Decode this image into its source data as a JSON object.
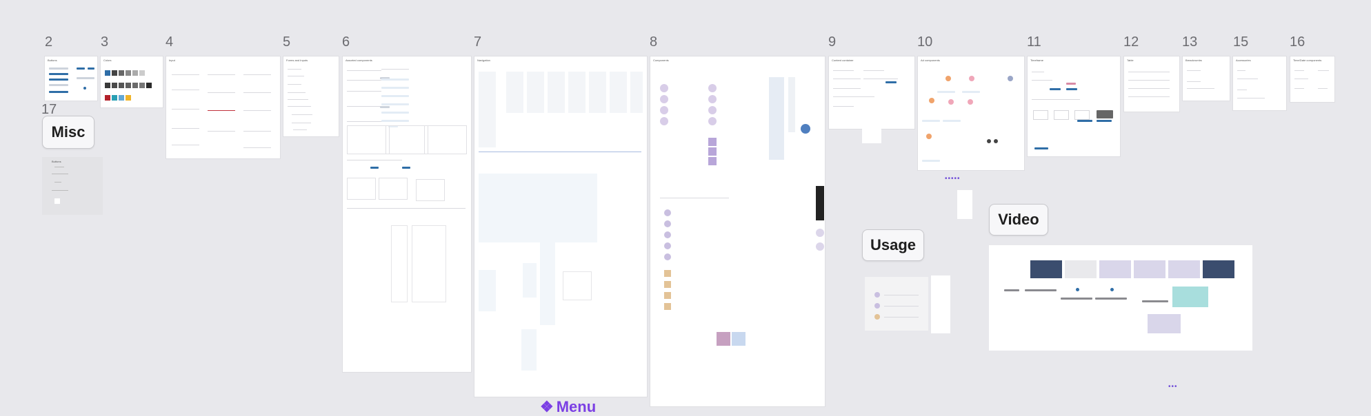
{
  "sections": {
    "n2": "2",
    "n3": "3",
    "n4": "4",
    "n5": "5",
    "n6": "6",
    "n7": "7",
    "n8": "8",
    "n9": "9",
    "n10": "10",
    "n11": "11",
    "n12": "12",
    "n13": "13",
    "n15": "15",
    "n16": "16",
    "n17": "17"
  },
  "labels": {
    "misc": "Misc",
    "usage": "Usage",
    "video": "Video",
    "menu": "Menu"
  },
  "frames": {
    "f2": "Buttons",
    "f3": "Colors",
    "f4": "Input",
    "f5": "Forms and Inputs",
    "f6": "Assorted components",
    "f7": "Navigation",
    "f8": "Components",
    "f9": "Content container",
    "f10": "Ad components",
    "f11": "Timeframe",
    "f12": "Table",
    "f13": "Breadcrumbs",
    "f15": "Accessories",
    "f16": "Time/Date components",
    "misc_panel": "Buttons"
  },
  "colors": {
    "accent": "#7b3fe4",
    "primary_blue": "#2f6ea7",
    "canvas": "#e8e8ec"
  },
  "icons": {
    "menu": "component-icon"
  }
}
